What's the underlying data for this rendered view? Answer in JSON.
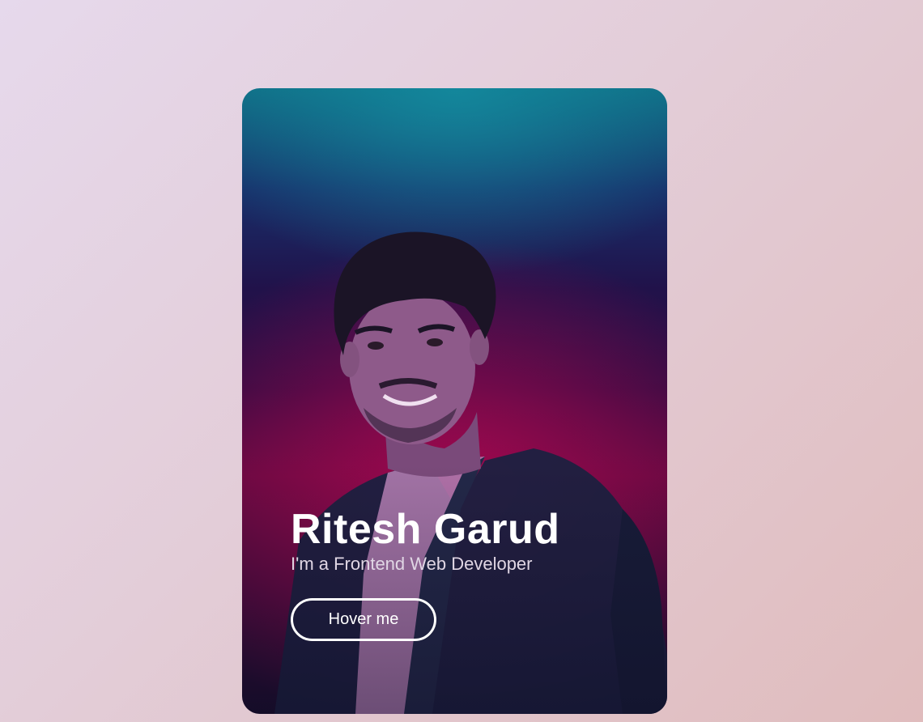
{
  "card": {
    "name": "Ritesh Garud",
    "role": "I'm a Frontend Web Developer",
    "button_label": "Hover me",
    "colors": {
      "page_bg_start": "#e6d9ec",
      "page_bg_end": "#e0bcbd",
      "card_top": "#0f6a82",
      "card_mid": "#21124a",
      "card_glow": "#a1084f",
      "text": "#ffffff"
    }
  }
}
